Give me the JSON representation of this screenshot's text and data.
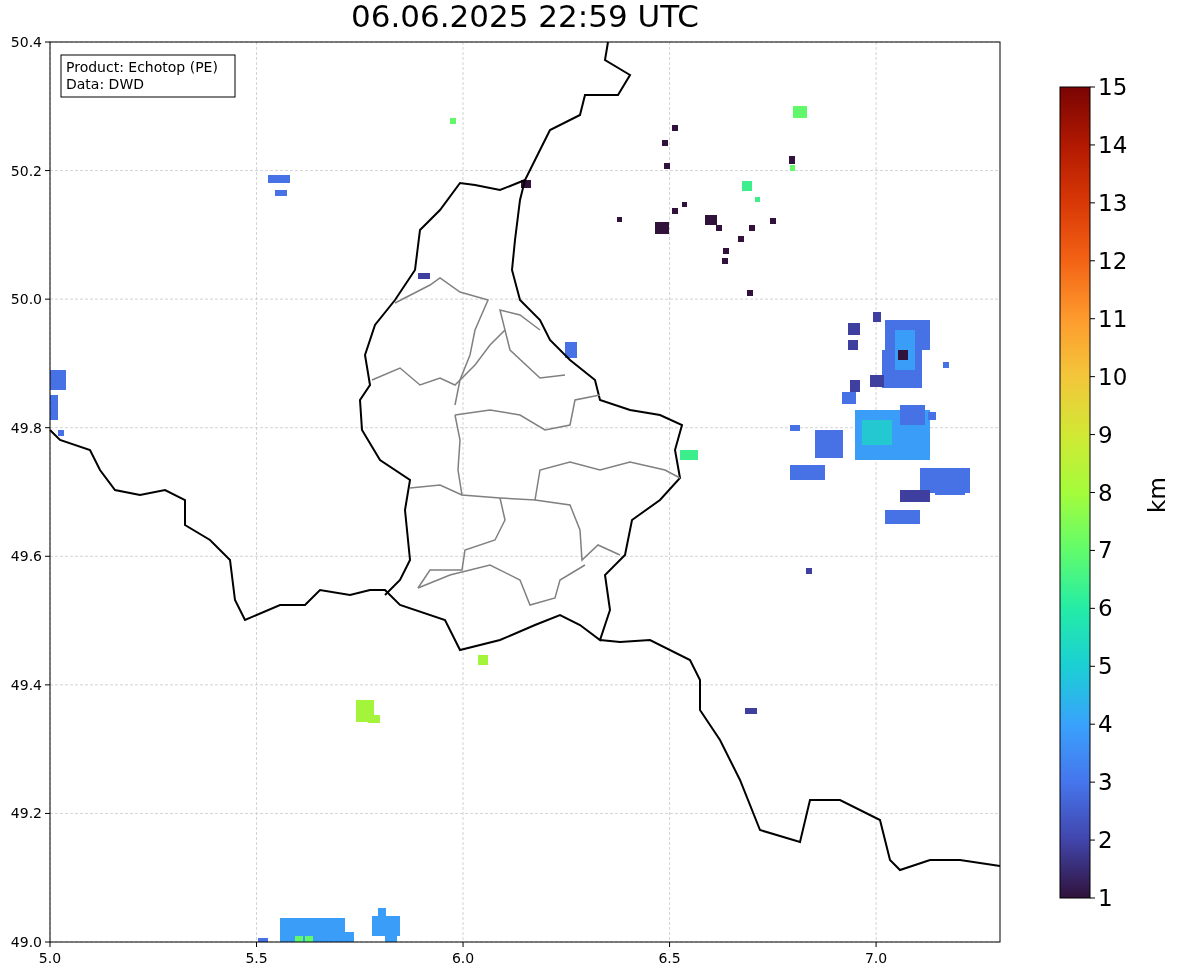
{
  "title": "06.06.2025 22:59 UTC",
  "info_box": [
    "Product: Echotop (PE)",
    "Data: DWD"
  ],
  "x_ticks": [
    "5.0",
    "5.5",
    "6.0",
    "6.5",
    "7.0"
  ],
  "y_ticks": [
    "50.4",
    "50.2",
    "50.0",
    "49.8",
    "49.6",
    "49.4",
    "49.2",
    "49.0"
  ],
  "colorbar": {
    "label": "km",
    "ticks": [
      "15",
      "14",
      "13",
      "12",
      "11",
      "10",
      "9",
      "8",
      "7",
      "6",
      "5",
      "4",
      "3",
      "2",
      "1"
    ]
  }
}
